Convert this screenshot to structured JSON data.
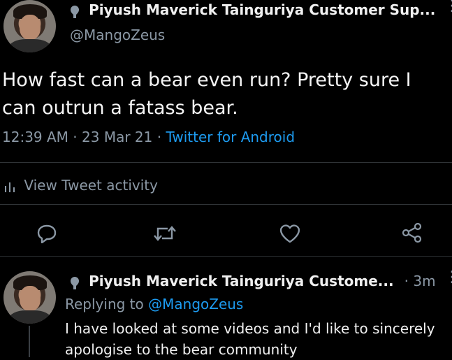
{
  "tweet": {
    "display_name": "Piyush Maverick Tainguriya Customer Sup...",
    "handle": "@MangoZeus",
    "text_line1": "How fast can a bear even run? Pretty sure I",
    "text_line2": "can outrun a fatass bear.",
    "time": "12:39 AM",
    "date": "23 Mar 21",
    "source": "Twitter for Android",
    "separator": "·",
    "activity_label": "View Tweet activity"
  },
  "reply": {
    "display_name": "Piyush Maverick Tainguriya Custome...",
    "time_ago": "· 3m",
    "replying_to_prefix": "Replying to",
    "replying_to_handle": "@MangoZeus",
    "text_line1": "I have looked at some videos and I'd like to sincerely",
    "text_line2": "apologise to the bear community"
  },
  "actions": [
    "reply-icon",
    "retweet-icon",
    "like-icon",
    "share-icon"
  ],
  "colors": {
    "background": "#000000",
    "text": "#e7e9ea",
    "muted": "#8b98a5",
    "link": "#1d9bf0",
    "divider": "#2f3336"
  }
}
